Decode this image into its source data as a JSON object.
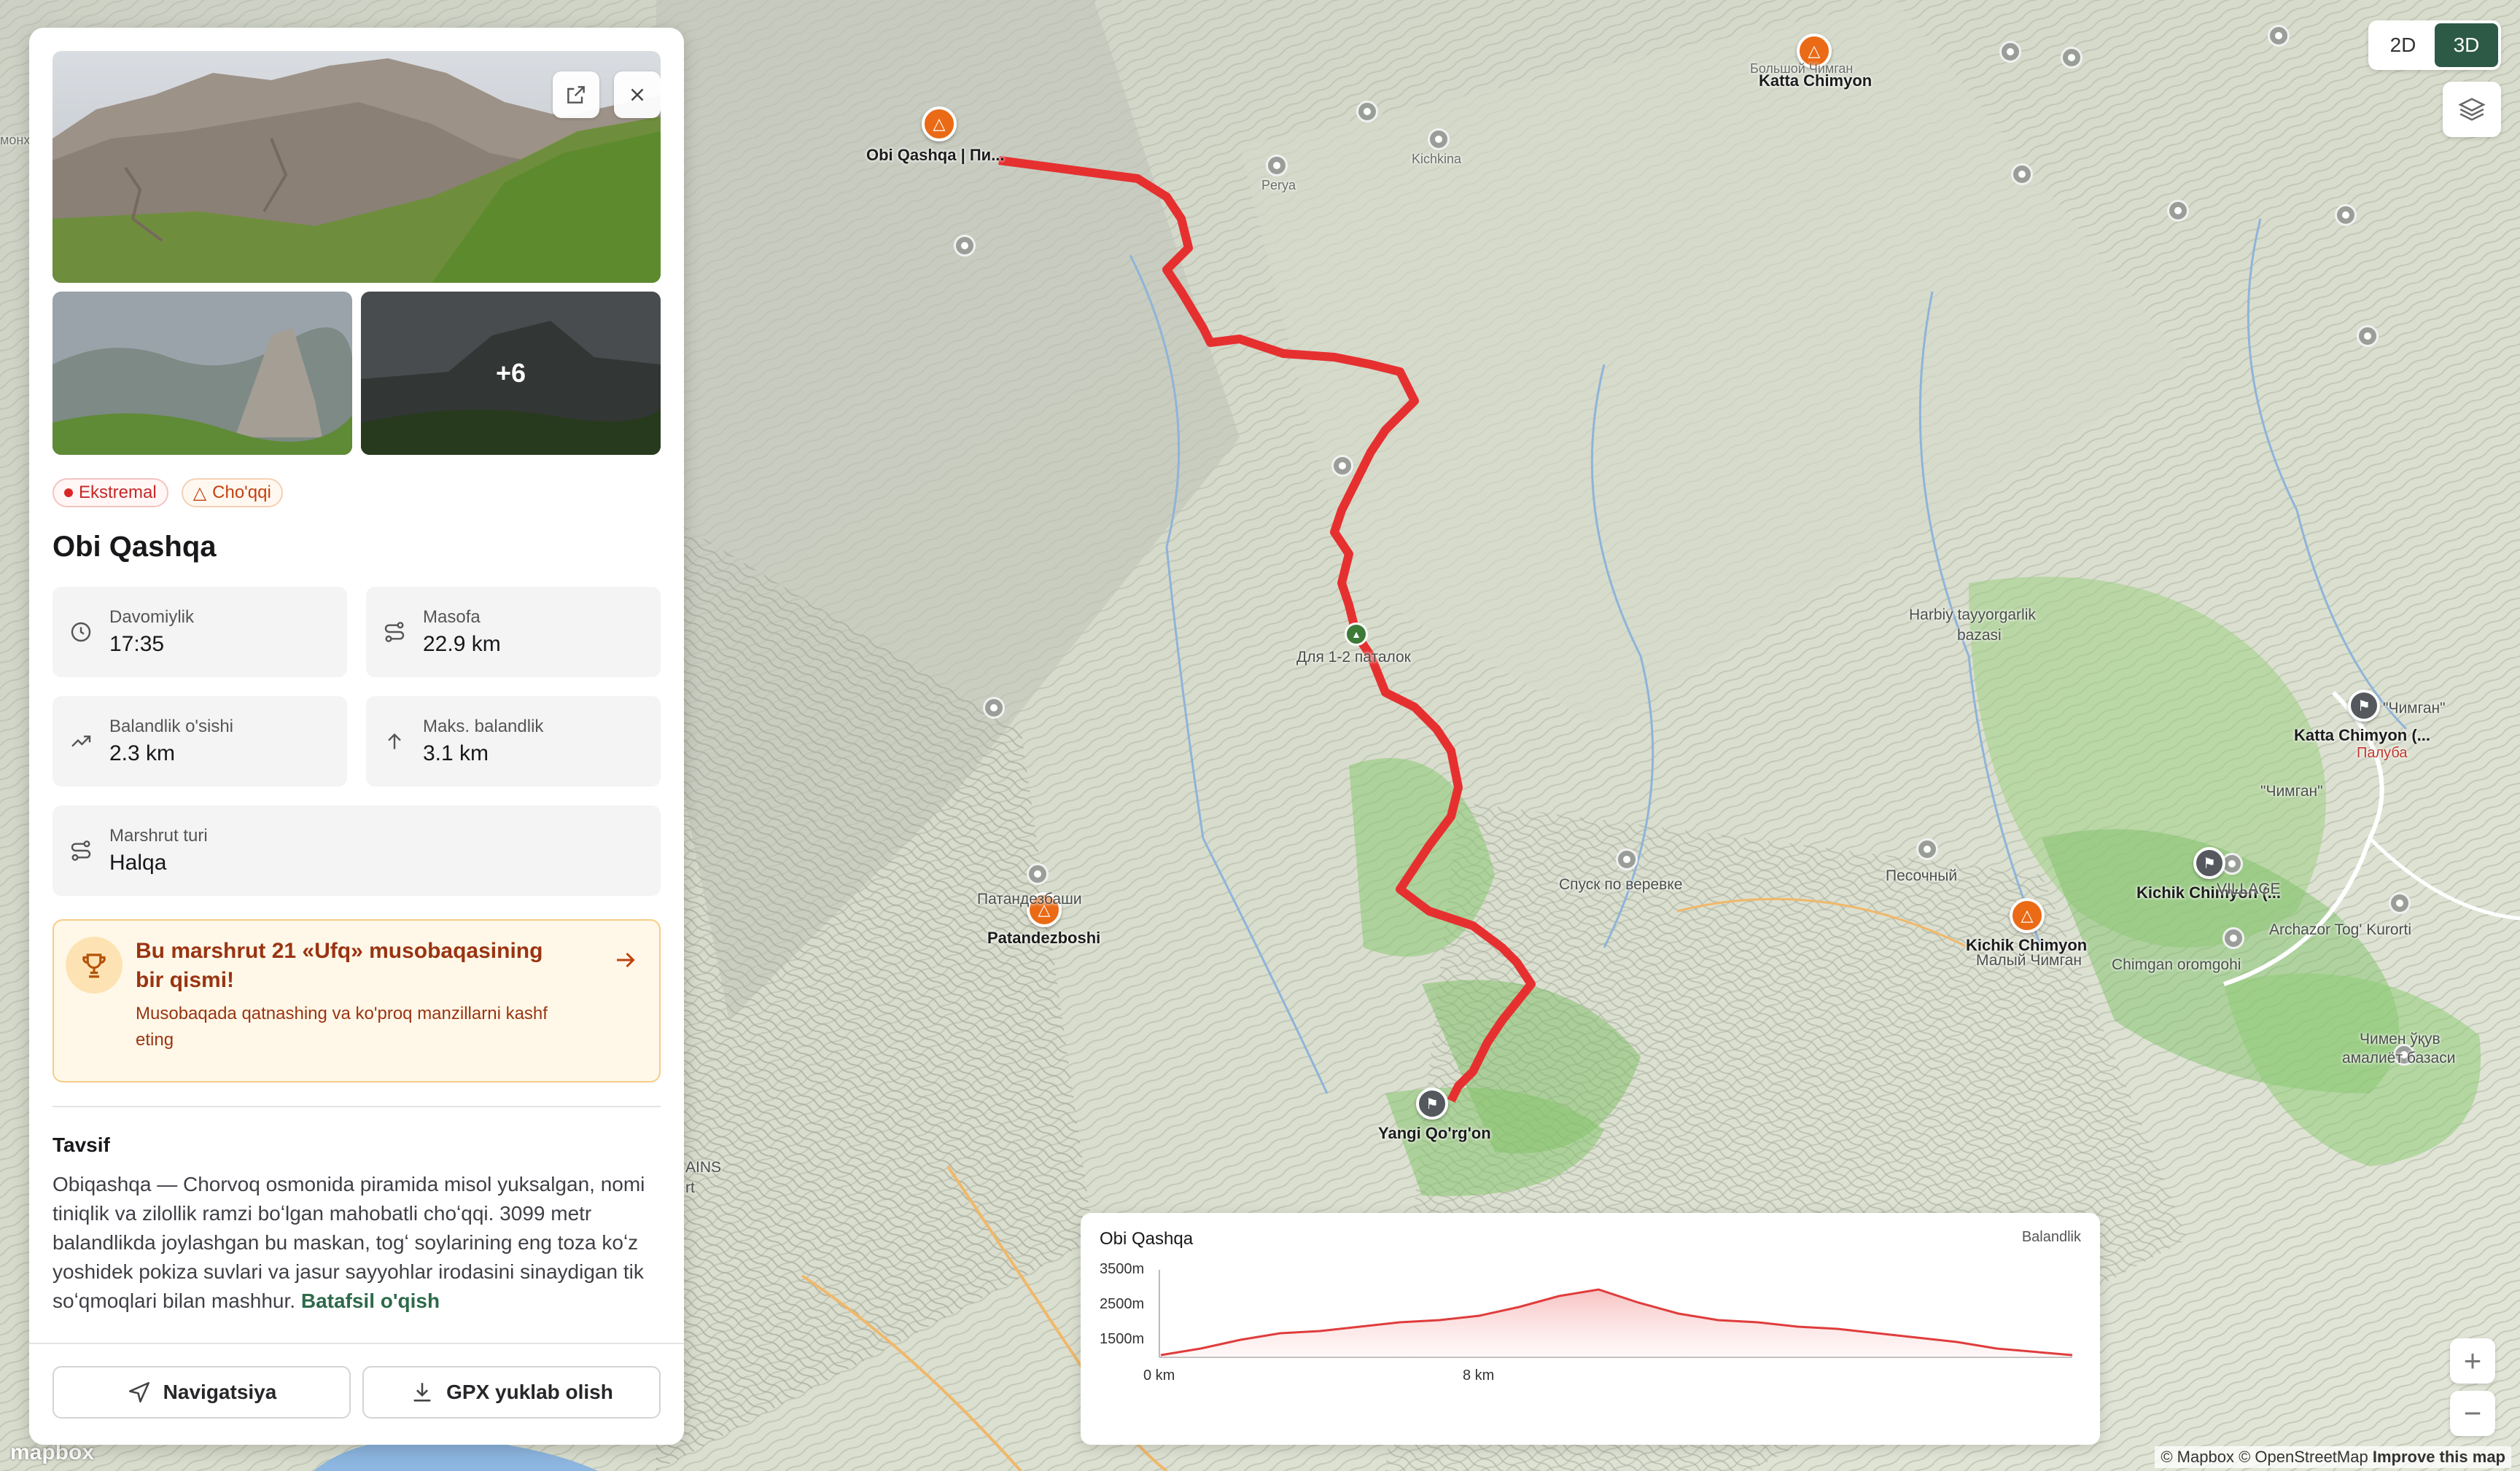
{
  "map": {
    "labels": {
      "obi_qashqa": "Obi Qashqa | Пи...",
      "katta_chimyon_top": "Katta Chimyon",
      "katta_chimyon_ru": "Большой Чимган",
      "perya": "Perya",
      "kichkina": "Kichkina",
      "dlya_palatok": "Для 1-2 паталок",
      "harbiy": "Harbiy tayyorgarlik",
      "harbiy2": "bazasi",
      "katta_chimyon_right": "Katta Chimyon (...",
      "palubа": "Палуба",
      "chimgan": "\"Чимган\"",
      "chimgan2": "\"Чимган\"",
      "kichik_chimyon_right": "Kichik Chimyon (...",
      "village": "VILLAGE",
      "pesochny": "Песочный",
      "spusk": "Спуск по веревке",
      "kichik_chimyon": "Kichik Chimyon",
      "maly_chimgan": "Малый Чимган",
      "chimgan_oromgohi": "Chimgan oromgohi",
      "archazor": "Archazor Tog' Kurorti",
      "patandezboshi": "Patandezboshi",
      "patandezboshi_ru": "Патандезбаши",
      "yangi_qorgon": "Yangi Qo'rg'on",
      "chimen_ukuv": "Чимен ўқув",
      "chimen_ukuv2": "амалиёт базаси",
      "mountains": "AINS",
      "rt": "rt",
      "monx": "монх"
    }
  },
  "controls": {
    "mode_2d": "2D",
    "mode_3d": "3D",
    "zoom_in": "+",
    "zoom_out": "−",
    "attribution_mapbox": "© Mapbox",
    "attribution_osm": "© OpenStreetMap",
    "attribution_improve": "Improve this map",
    "mapbox_logo": "mapbox"
  },
  "panel": {
    "photos_more": "+6",
    "tags": [
      {
        "label": "Ekstremal"
      },
      {
        "label": "Cho'qqi"
      }
    ],
    "title": "Obi Qashqa",
    "stats": {
      "duration_label": "Davomiylik",
      "duration_value": "17:35",
      "distance_label": "Masofa",
      "distance_value": "22.9 km",
      "gain_label": "Balandlik o'sishi",
      "gain_value": "2.3 km",
      "max_label": "Maks. balandlik",
      "max_value": "3.1 km",
      "type_label": "Marshrut turi",
      "type_value": "Halqa"
    },
    "promo": {
      "title": "Bu marshrut 21 «Ufq» musobaqasining bir qismi!",
      "subtitle": "Musobaqada qatnashing va ko'proq manzillarni kashf eting"
    },
    "description_heading": "Tavsif",
    "description": "Obiqashqa — Chorvoq osmonida piramida misol yuksalgan, nomi tiniqlik va zilollik ramzi boʻlgan mahobatli choʻqqi. 3099 metr balandlikda joylashgan bu maskan, togʻ soylarining eng toza koʻz yoshidek pokiza suvlari va jasur sayyohlar irodasini sinaydigan tik soʻqmoqlari bilan mashhur.",
    "read_more": "Batafsil o'qish",
    "navigate_label": "Navigatsiya",
    "gpx_label": "GPX yuklab olish"
  },
  "elevation": {
    "title": "Obi Qashqa",
    "label": "Balandlik",
    "y_ticks": [
      "3500m",
      "2500m",
      "1500m"
    ],
    "x_ticks": [
      "0 km",
      "8 km"
    ]
  },
  "chart_data": {
    "type": "area",
    "title": "Obi Qashqa",
    "ylabel": "Balandlik",
    "ylim": [
      1500,
      3500
    ],
    "x_ticks": [
      "0 km",
      "8 km"
    ],
    "x": [
      0,
      1,
      2,
      3,
      4,
      5,
      6,
      7,
      8,
      9,
      10,
      11,
      12,
      13,
      14,
      15,
      16,
      17,
      18,
      19,
      20,
      21,
      22.9
    ],
    "values": [
      1550,
      1700,
      1900,
      2050,
      2100,
      2200,
      2300,
      2350,
      2450,
      2650,
      2900,
      3050,
      2750,
      2500,
      2350,
      2300,
      2200,
      2150,
      2050,
      1950,
      1850,
      1700,
      1550
    ]
  }
}
